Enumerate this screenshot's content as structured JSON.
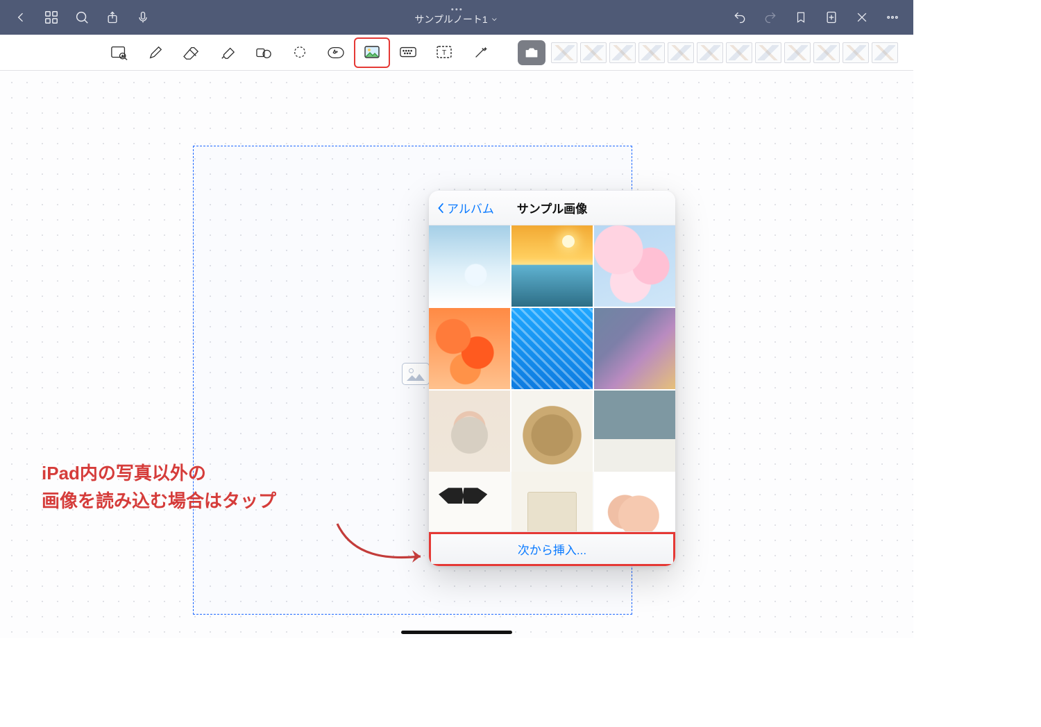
{
  "navbar": {
    "title": "サンプルノート1"
  },
  "popup": {
    "back_label": "アルバム",
    "title": "サンプル画像",
    "insert_from_label": "次から挿入..."
  },
  "annotation": {
    "line1": "iPad内の写真以外の",
    "line2": "画像を読み込む場合はタップ"
  },
  "thumbnails": {
    "count": 12
  }
}
